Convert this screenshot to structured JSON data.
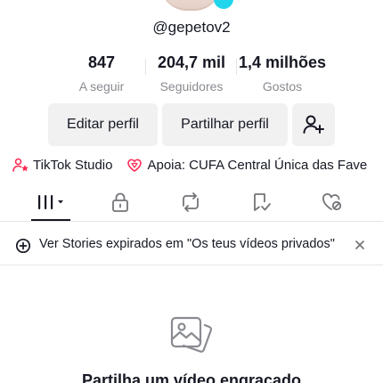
{
  "profile": {
    "username": "@gepetov2"
  },
  "stats": {
    "following": {
      "value": "847",
      "label": "A seguir"
    },
    "followers": {
      "value": "204,7 mil",
      "label": "Seguidores"
    },
    "likes": {
      "value": "1,4 milhões",
      "label": "Gostos"
    }
  },
  "actions": {
    "edit_label": "Editar perfil",
    "share_label": "Partilhar perfil",
    "add_friend_icon": "add-user-icon"
  },
  "links": [
    {
      "label": "TikTok Studio",
      "icon": "person-star-icon",
      "color": "#fe2c55"
    },
    {
      "label": "Apoia: CUFA Central Única das Fave",
      "icon": "heart-gem-icon",
      "color": "#fe2c55"
    }
  ],
  "tabs": [
    {
      "name": "videos",
      "icon": "grid-bars-icon",
      "active": true
    },
    {
      "name": "private",
      "icon": "lock-icon"
    },
    {
      "name": "reposts",
      "icon": "repost-icon"
    },
    {
      "name": "favorites",
      "icon": "bookmark-icon"
    },
    {
      "name": "liked",
      "icon": "heart-hidden-icon"
    }
  ],
  "banner": {
    "text": "Ver Stories expirados em \"Os teus vídeos privados\"",
    "icon": "story-plus-icon",
    "close_icon": "close-icon"
  },
  "empty_state": {
    "icon": "photos-icon",
    "title": "Partilha um vídeo engraçado"
  },
  "colors": {
    "accent": "#fe2c55",
    "verified": "#20d5ec",
    "button_bg": "#f1f1f2",
    "muted_text": "#8a8b91"
  }
}
